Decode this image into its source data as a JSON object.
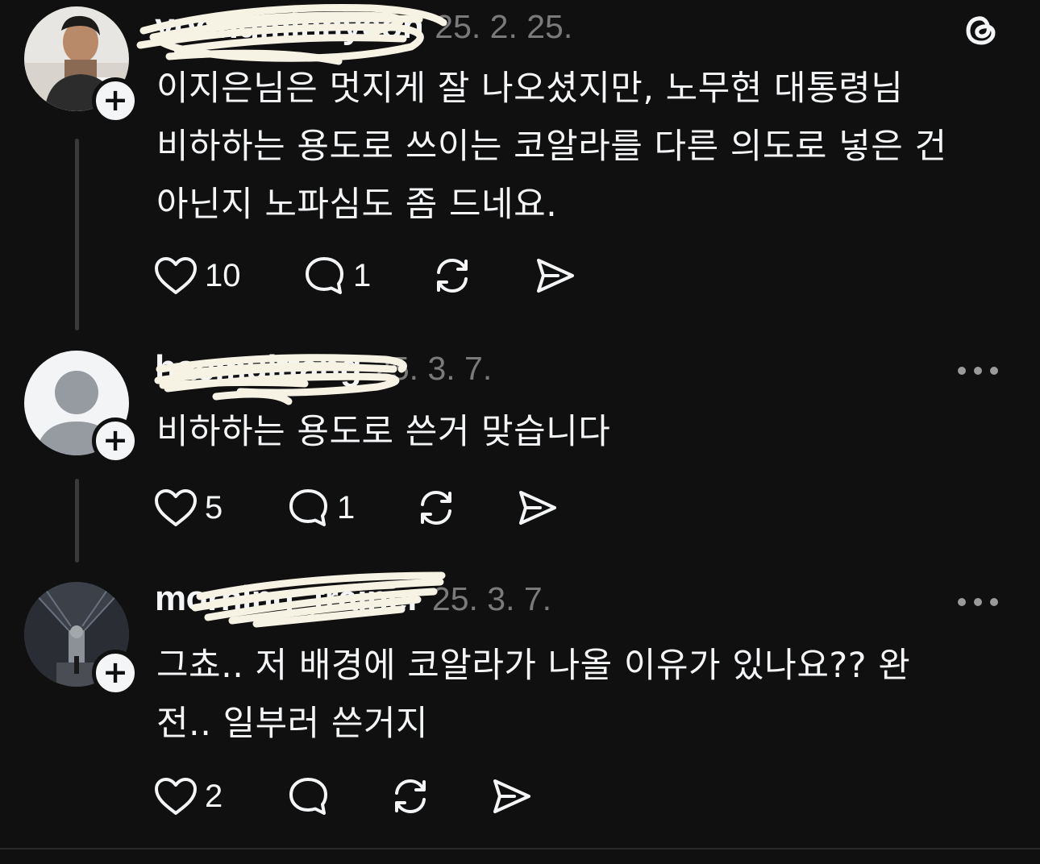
{
  "app": {
    "logo_icon": "threads-logo-icon"
  },
  "colors": {
    "background": "#101010",
    "text_primary": "#f3f5f7",
    "text_secondary": "#7a7a7a",
    "thread_line": "#3a3a3a"
  },
  "posts": [
    {
      "username": "yoongminhyeon",
      "date": "25. 2. 25.",
      "text": "이지은님은 멋지게 잘 나오셨지만, 노무현 대통령님\n비하하는 용도로 쓰이는 코알라를 다른 의도로 넣은 건\n아닌지 노파심도 좀 드네요.",
      "likes": "10",
      "replies": "1",
      "avatar_icon": "profile-photo-man"
    },
    {
      "username": "haemulttang",
      "date": "25. 3. 7.",
      "text": "비하하는 용도로 쓴거 맞습니다",
      "likes": "5",
      "replies": "1",
      "avatar_icon": "default-avatar-icon"
    },
    {
      "username": "morning_trainer",
      "date": "25. 3. 7.",
      "text": "그쵸.. 저 배경에 코알라가 나올 이유가 있나요?? 완\n전.. 일부러 쓴거지",
      "likes": "2",
      "replies": "",
      "avatar_icon": "profile-photo-corridor"
    }
  ]
}
